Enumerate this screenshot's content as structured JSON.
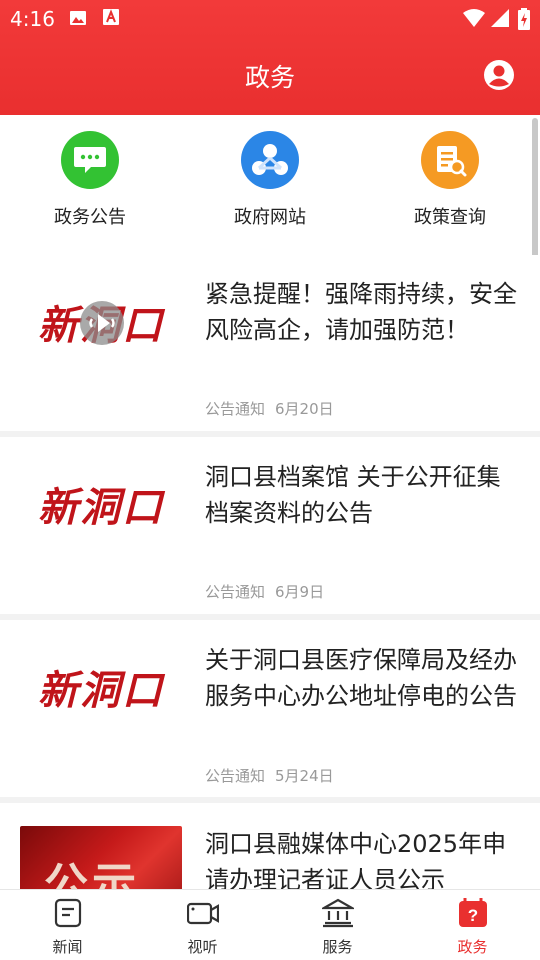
{
  "status_bar": {
    "time": "4:16"
  },
  "header": {
    "title": "政务"
  },
  "quick_links": [
    {
      "label": "政务公告",
      "icon": "chat-bubble-icon",
      "color": "#33c233"
    },
    {
      "label": "政府网站",
      "icon": "network-nodes-icon",
      "color": "#2b86e6"
    },
    {
      "label": "政策查询",
      "icon": "document-search-icon",
      "color": "#f59a23"
    }
  ],
  "news": [
    {
      "title": "紧急提醒！强降雨持续，安全风险高企，请加强防范！",
      "category": "公告通知",
      "date": "6月20日",
      "thumb_logo": "新洞口"
    },
    {
      "title": "洞口县档案馆 关于公开征集档案资料的公告",
      "category": "公告通知",
      "date": "6月9日",
      "thumb_logo": "新洞口"
    },
    {
      "title": "关于洞口县医疗保障局及经办服务中心办公地址停电的公告",
      "category": "公告通知",
      "date": "5月24日",
      "thumb_logo": "新洞口"
    },
    {
      "title": "洞口县融媒体中心2025年申请办理记者证人员公示",
      "thumb_text": "公示"
    }
  ],
  "bottom_nav": [
    {
      "label": "新闻",
      "icon": "news-icon"
    },
    {
      "label": "视听",
      "icon": "video-icon"
    },
    {
      "label": "服务",
      "icon": "bank-icon"
    },
    {
      "label": "政务",
      "icon": "question-icon",
      "active": true,
      "active_color": "#e9302f"
    }
  ]
}
